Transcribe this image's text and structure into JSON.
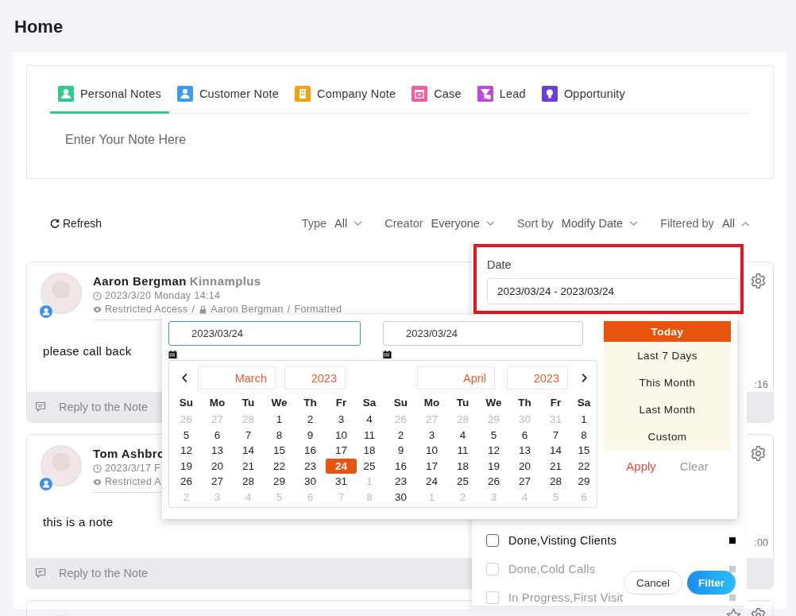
{
  "page": {
    "title": "Home"
  },
  "editor": {
    "tabs": [
      {
        "label": "Personal Notes",
        "color": "#2ecc8a",
        "selected": true
      },
      {
        "label": "Customer Note",
        "color": "#3d9cf0",
        "selected": false
      },
      {
        "label": "Company Note",
        "color": "#f5a20a",
        "selected": false
      },
      {
        "label": "Case",
        "color": "#f55fa0",
        "selected": false
      },
      {
        "label": "Lead",
        "color": "#c247e0",
        "selected": false
      },
      {
        "label": "Opportunity",
        "color": "#6b3fd6",
        "selected": false
      }
    ],
    "placeholder": "Enter Your Note Here"
  },
  "toolbar": {
    "refresh": "Refresh",
    "filters": [
      {
        "label": "Type",
        "value": "All",
        "expanded": false
      },
      {
        "label": "Creator",
        "value": "Everyone",
        "expanded": false
      },
      {
        "label": "Sort by",
        "value": "Modify Date",
        "expanded": false
      },
      {
        "label": "Filtered by",
        "value": "All",
        "expanded": true
      }
    ]
  },
  "notes": [
    {
      "kind": "full",
      "author": "Aaron Bergman",
      "company": "Kinnamplus",
      "date": "2023/3/20",
      "weekday": "Monday",
      "time": "14:14",
      "access": [
        {
          "kind": "access",
          "text": "Restricted Access"
        },
        {
          "kind": "separator",
          "text": "/"
        },
        {
          "kind": "owner",
          "text": "Aaron Bergman"
        },
        {
          "kind": "separator",
          "text": "/"
        },
        {
          "kind": "status",
          "text": "Formatted"
        }
      ],
      "body": "please call back",
      "time_fragment": ":16",
      "reply": "Reply to the Note"
    },
    {
      "kind": "full",
      "author": "Tom Ashbro",
      "date": "2023/3/17 F",
      "access": [
        {
          "kind": "access",
          "text": "Restricted A"
        }
      ],
      "body": "this is a note",
      "time_fragment": ":00",
      "reply": "Reply to the Note"
    },
    {
      "kind": "partial"
    }
  ],
  "filter_panel": {
    "date_label": "Date",
    "date_value": "2023/03/24 - 2023/03/24",
    "highlighted": true,
    "statuses": [
      {
        "label": "Done,Visting Clients",
        "checked": false,
        "dimmed": false
      },
      {
        "label": "Done,Cold Calls",
        "checked": false,
        "dimmed": true
      },
      {
        "label": "In Progress,First Visit",
        "checked": false,
        "dimmed": true
      }
    ],
    "cancel": "Cancel",
    "submit": "Filter"
  },
  "date_picker": {
    "start": "2023/03/24",
    "end": "2023/03/24",
    "months": [
      {
        "month": "March",
        "year": "2023",
        "weekdays": [
          "Su",
          "Mo",
          "Tu",
          "We",
          "Th",
          "Fr",
          "Sa"
        ],
        "weeks": [
          [
            {
              "d": "26",
              "out": true,
              "selected": false
            },
            {
              "d": "27",
              "out": true,
              "selected": false
            },
            {
              "d": "28",
              "out": true,
              "selected": false
            },
            {
              "d": "1",
              "out": false,
              "selected": false
            },
            {
              "d": "2",
              "out": false,
              "selected": false
            },
            {
              "d": "3",
              "out": false,
              "selected": false
            },
            {
              "d": "4",
              "out": false,
              "selected": false
            }
          ],
          [
            {
              "d": "5",
              "out": false,
              "selected": false
            },
            {
              "d": "6",
              "out": false,
              "selected": false
            },
            {
              "d": "7",
              "out": false,
              "selected": false
            },
            {
              "d": "8",
              "out": false,
              "selected": false
            },
            {
              "d": "9",
              "out": false,
              "selected": false
            },
            {
              "d": "10",
              "out": false,
              "selected": false
            },
            {
              "d": "11",
              "out": false,
              "selected": false
            }
          ],
          [
            {
              "d": "12",
              "out": false,
              "selected": false
            },
            {
              "d": "13",
              "out": false,
              "selected": false
            },
            {
              "d": "14",
              "out": false,
              "selected": false
            },
            {
              "d": "15",
              "out": false,
              "selected": false
            },
            {
              "d": "16",
              "out": false,
              "selected": false
            },
            {
              "d": "17",
              "out": false,
              "selected": false
            },
            {
              "d": "18",
              "out": false,
              "selected": false
            }
          ],
          [
            {
              "d": "19",
              "out": false,
              "selected": false
            },
            {
              "d": "20",
              "out": false,
              "selected": false
            },
            {
              "d": "21",
              "out": false,
              "selected": false
            },
            {
              "d": "22",
              "out": false,
              "selected": false
            },
            {
              "d": "23",
              "out": false,
              "selected": false
            },
            {
              "d": "24",
              "out": false,
              "selected": true
            },
            {
              "d": "25",
              "out": false,
              "selected": false
            }
          ],
          [
            {
              "d": "26",
              "out": false,
              "selected": false
            },
            {
              "d": "27",
              "out": false,
              "selected": false
            },
            {
              "d": "28",
              "out": false,
              "selected": false
            },
            {
              "d": "29",
              "out": false,
              "selected": false
            },
            {
              "d": "30",
              "out": false,
              "selected": false
            },
            {
              "d": "31",
              "out": false,
              "selected": false
            },
            {
              "d": "1",
              "out": true,
              "selected": false
            }
          ],
          [
            {
              "d": "2",
              "out": true,
              "selected": false
            },
            {
              "d": "3",
              "out": true,
              "selected": false
            },
            {
              "d": "4",
              "out": true,
              "selected": false
            },
            {
              "d": "5",
              "out": true,
              "selected": false
            },
            {
              "d": "6",
              "out": true,
              "selected": false
            },
            {
              "d": "7",
              "out": true,
              "selected": false
            },
            {
              "d": "8",
              "out": true,
              "selected": false
            }
          ]
        ]
      },
      {
        "month": "April",
        "year": "2023",
        "weekdays": [
          "Su",
          "Mo",
          "Tu",
          "We",
          "Th",
          "Fr",
          "Sa"
        ],
        "weeks": [
          [
            {
              "d": "26",
              "out": true,
              "selected": false
            },
            {
              "d": "27",
              "out": true,
              "selected": false
            },
            {
              "d": "28",
              "out": true,
              "selected": false
            },
            {
              "d": "29",
              "out": true,
              "selected": false
            },
            {
              "d": "30",
              "out": true,
              "selected": false
            },
            {
              "d": "31",
              "out": true,
              "selected": false
            },
            {
              "d": "1",
              "out": false,
              "selected": false
            }
          ],
          [
            {
              "d": "2",
              "out": false,
              "selected": false
            },
            {
              "d": "3",
              "out": false,
              "selected": false
            },
            {
              "d": "4",
              "out": false,
              "selected": false
            },
            {
              "d": "5",
              "out": false,
              "selected": false
            },
            {
              "d": "6",
              "out": false,
              "selected": false
            },
            {
              "d": "7",
              "out": false,
              "selected": false
            },
            {
              "d": "8",
              "out": false,
              "selected": false
            }
          ],
          [
            {
              "d": "9",
              "out": false,
              "selected": false
            },
            {
              "d": "10",
              "out": false,
              "selected": false
            },
            {
              "d": "11",
              "out": false,
              "selected": false
            },
            {
              "d": "12",
              "out": false,
              "selected": false
            },
            {
              "d": "13",
              "out": false,
              "selected": false
            },
            {
              "d": "14",
              "out": false,
              "selected": false
            },
            {
              "d": "15",
              "out": false,
              "selected": false
            }
          ],
          [
            {
              "d": "16",
              "out": false,
              "selected": false
            },
            {
              "d": "17",
              "out": false,
              "selected": false
            },
            {
              "d": "18",
              "out": false,
              "selected": false
            },
            {
              "d": "19",
              "out": false,
              "selected": false
            },
            {
              "d": "20",
              "out": false,
              "selected": false
            },
            {
              "d": "21",
              "out": false,
              "selected": false
            },
            {
              "d": "22",
              "out": false,
              "selected": false
            }
          ],
          [
            {
              "d": "23",
              "out": false,
              "selected": false
            },
            {
              "d": "24",
              "out": false,
              "selected": false
            },
            {
              "d": "25",
              "out": false,
              "selected": false
            },
            {
              "d": "26",
              "out": false,
              "selected": false
            },
            {
              "d": "27",
              "out": false,
              "selected": false
            },
            {
              "d": "28",
              "out": false,
              "selected": false
            },
            {
              "d": "29",
              "out": false,
              "selected": false
            }
          ],
          [
            {
              "d": "30",
              "out": false,
              "selected": false
            },
            {
              "d": "1",
              "out": true,
              "selected": false
            },
            {
              "d": "2",
              "out": true,
              "selected": false
            },
            {
              "d": "3",
              "out": true,
              "selected": false
            },
            {
              "d": "4",
              "out": true,
              "selected": false
            },
            {
              "d": "5",
              "out": true,
              "selected": false
            },
            {
              "d": "6",
              "out": true,
              "selected": false
            }
          ]
        ]
      }
    ],
    "ranges": [
      {
        "label": "Today",
        "selected": true
      },
      {
        "label": "Last 7 Days",
        "selected": false
      },
      {
        "label": "This Month",
        "selected": false
      },
      {
        "label": "Last Month",
        "selected": false
      },
      {
        "label": "Custom",
        "selected": false
      }
    ],
    "apply": "Apply",
    "clear": "Clear"
  }
}
